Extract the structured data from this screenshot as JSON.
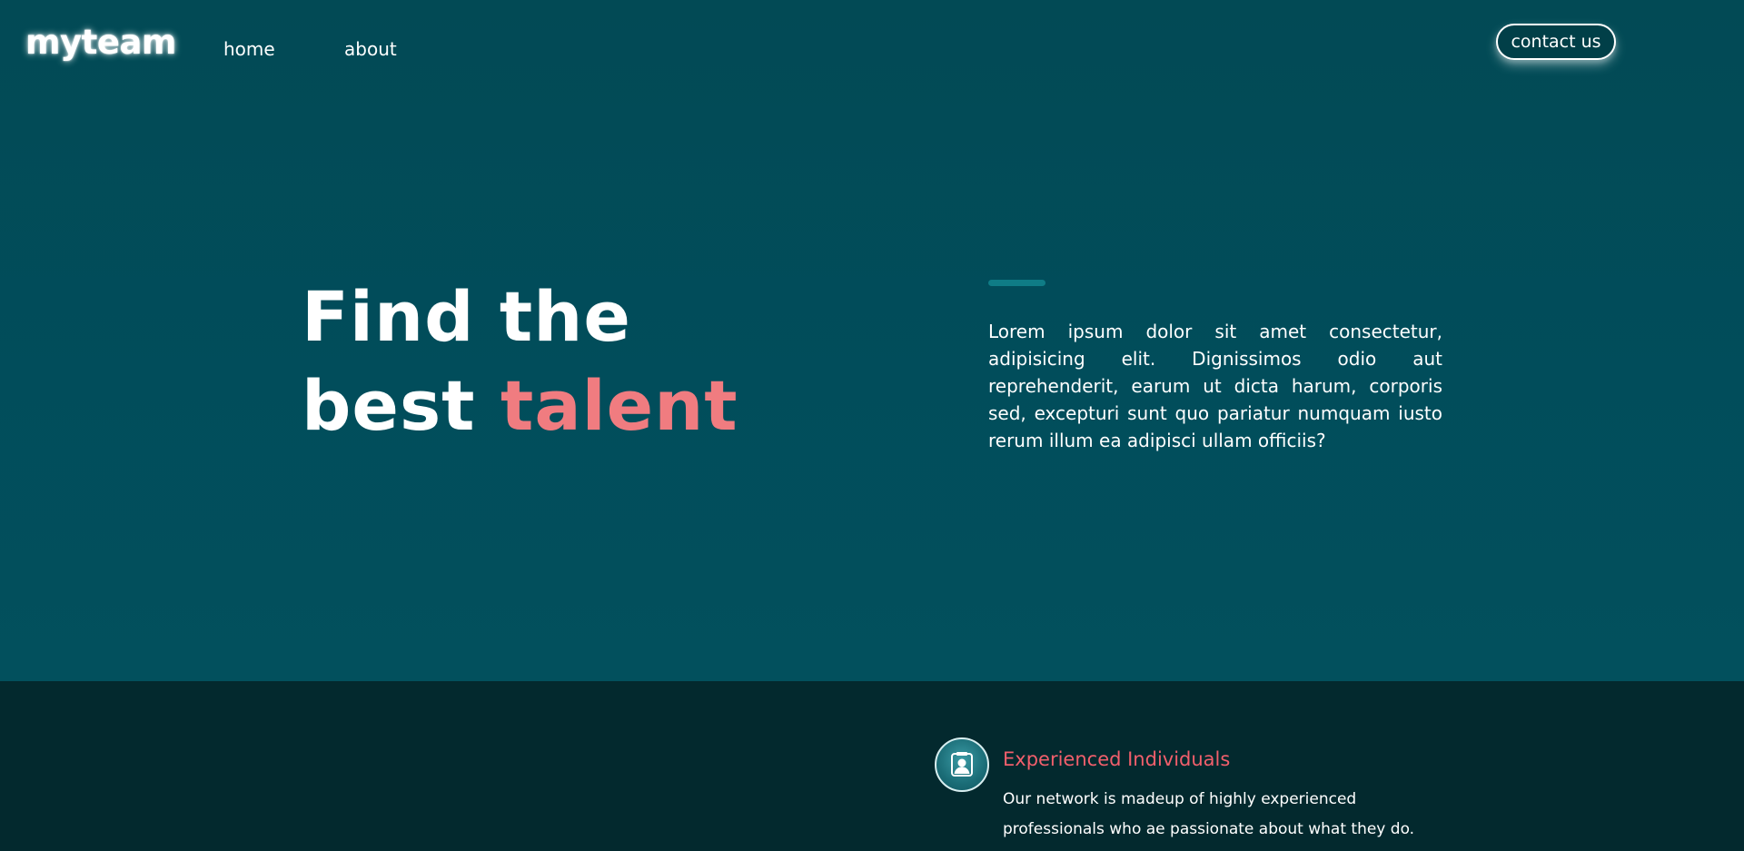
{
  "header": {
    "logo": "myteam",
    "nav": [
      {
        "label": "home"
      },
      {
        "label": "about"
      }
    ],
    "contact_label": "contact us"
  },
  "hero": {
    "headline_line1": "Find the",
    "headline_line2_prefix": "best ",
    "headline_accent": "talent",
    "description": "Lorem ipsum dolor sit amet consectetur, adipisicing elit. Dignissimos odio aut reprehenderit, earum ut dicta harum, corporis sed, excepturi sunt quo pariatur numquam iusto rerum illum ea adipisci ullam officiis?"
  },
  "features": {
    "items": [
      {
        "icon": "user-icon",
        "title": "Experienced Individuals",
        "description": "Our network is madeup of highly experienced professionals who ae passionate about what they do."
      }
    ]
  },
  "colors": {
    "hero_bg": "#014d5b",
    "features_bg": "#03292e",
    "accent_pink": "#f07c80",
    "feature_title": "#f25f6c",
    "accent_bar": "#0f7c86"
  }
}
